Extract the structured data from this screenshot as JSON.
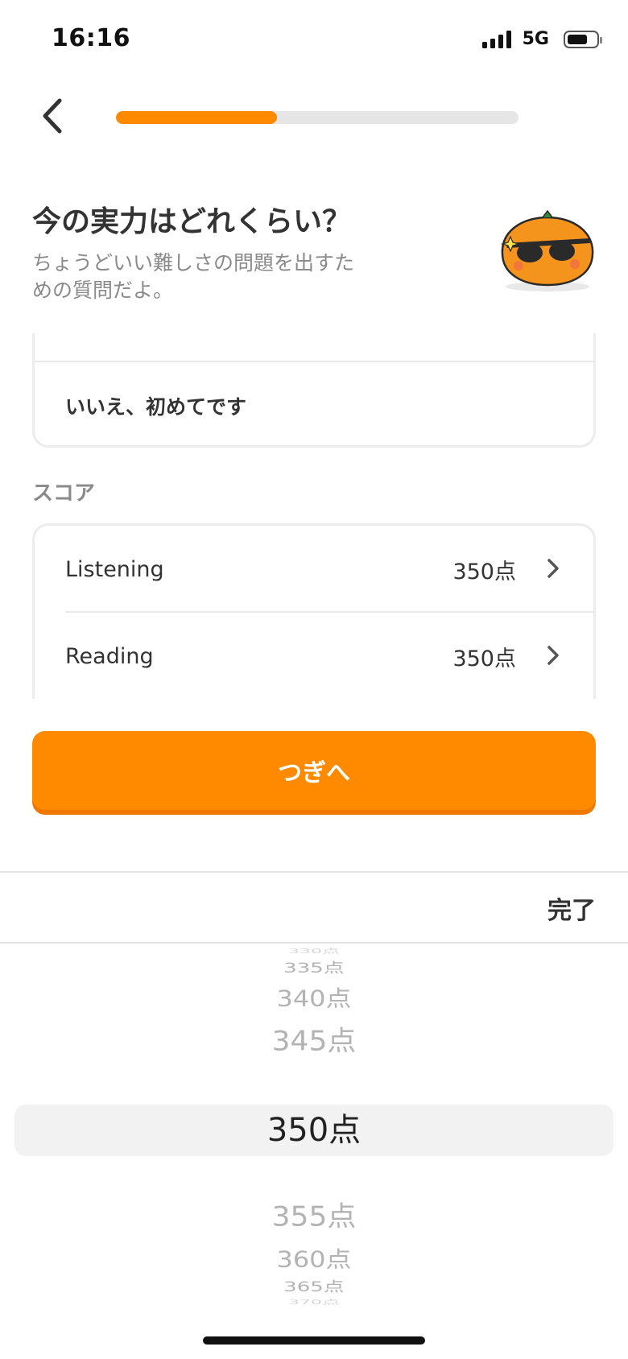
{
  "status_bar": {
    "time": "16:16",
    "network": "5G"
  },
  "onboarding": {
    "progress_percent": 40
  },
  "header": {
    "title": "今の実力はどれくらい？",
    "subtitle": "ちょうどいい難しさの問題を出すための質問だよ。",
    "mascot": "orange-mascot-sunglasses"
  },
  "experience_card": {
    "option_label": "いいえ、初めてです"
  },
  "score_section": {
    "label": "スコア",
    "rows": [
      {
        "label": "Listening",
        "value": "350点"
      },
      {
        "label": "Reading",
        "value": "350点"
      }
    ]
  },
  "next_button": {
    "label": "つぎへ"
  },
  "picker": {
    "done_label": "完了",
    "items": [
      "330点",
      "335点",
      "340点",
      "345点",
      "350点",
      "355点",
      "360点",
      "365点",
      "370点"
    ],
    "selected": "350点"
  },
  "colors": {
    "accent": "#ff8a00",
    "accent_shadow": "#f07800",
    "track": "#e6e6e6"
  }
}
